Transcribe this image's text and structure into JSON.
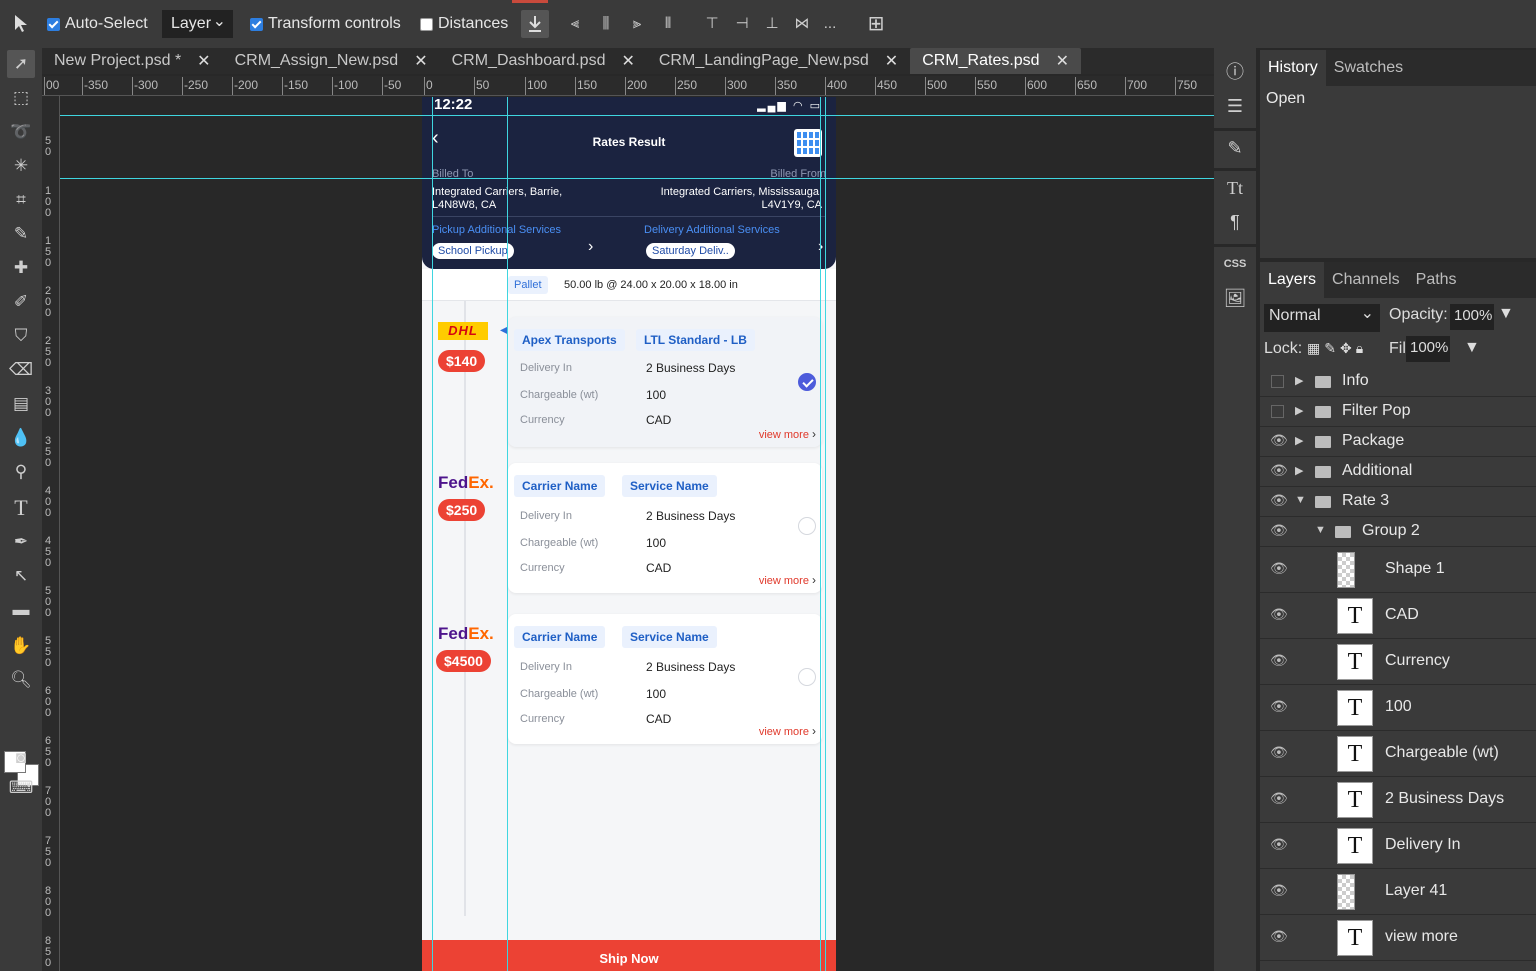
{
  "options_bar": {
    "auto_select_label": "Auto-Select",
    "auto_select_checked": true,
    "layer_select_value": "Layer",
    "transform_controls_label": "Transform controls",
    "transform_controls_checked": true,
    "distances_label": "Distances",
    "distances_checked": false,
    "more_label": "..."
  },
  "tabs": [
    {
      "label": "New Project.psd *",
      "active": false
    },
    {
      "label": "CRM_Assign_New.psd",
      "active": false
    },
    {
      "label": "CRM_Dashboard.psd",
      "active": false
    },
    {
      "label": "CRM_LandingPage_New.psd",
      "active": false
    },
    {
      "label": "CRM_Rates.psd",
      "active": true
    }
  ],
  "ruler": {
    "top_labels": [
      "00",
      "-350",
      "-300",
      "-250",
      "-200",
      "-150",
      "-100",
      "-50",
      "0",
      "50",
      "100",
      "150",
      "200",
      "250",
      "300",
      "350",
      "400",
      "450",
      "500",
      "550",
      "600",
      "650",
      "700",
      "750"
    ],
    "left_labels": [
      "50",
      "100",
      "150",
      "200",
      "250",
      "300",
      "350",
      "400",
      "450",
      "500",
      "550",
      "600",
      "650",
      "700",
      "750",
      "800",
      "850"
    ]
  },
  "artboard": {
    "status_time": "12:22",
    "title": "Rates Result",
    "billed_to_label": "Billed To",
    "billed_to_line1": "Integrated Carriers, Barrie,",
    "billed_to_line2": "L4N8W8, CA",
    "billed_from_label": "Billed From",
    "billed_from_line1": "Integrated Carriers, Mississauga,",
    "billed_from_line2": "L4V1Y9, CA",
    "pickup_label": "Pickup Additional Services",
    "pickup_chip": "School Pickup",
    "delivery_label": "Delivery Additional Services",
    "delivery_chip": "Saturday Deliv..",
    "pallet_chip": "Pallet",
    "pallet_text": "50.00 lb @ 24.00 x 20.00 x 18.00 in",
    "rates": [
      {
        "carrier": "DHL",
        "price": "$140",
        "chip1": "Apex Transports",
        "chip2": "LTL Standard - LB",
        "delivery_label": "Delivery In",
        "delivery_value": "2 Business Days",
        "weight_label": "Chargeable (wt)",
        "weight_value": "100",
        "currency_label": "Currency",
        "currency_value": "CAD",
        "view_more": "view more",
        "selected": true
      },
      {
        "carrier": "FedEx",
        "price": "$250",
        "chip1": "Carrier Name",
        "chip2": "Service Name",
        "delivery_label": "Delivery In",
        "delivery_value": "2 Business Days",
        "weight_label": "Chargeable (wt)",
        "weight_value": "100",
        "currency_label": "Currency",
        "currency_value": "CAD",
        "view_more": "view more",
        "selected": false
      },
      {
        "carrier": "FedEx",
        "price": "$4500",
        "chip1": "Carrier Name",
        "chip2": "Service Name",
        "delivery_label": "Delivery In",
        "delivery_value": "2 Business Days",
        "weight_label": "Chargeable (wt)",
        "weight_value": "100",
        "currency_label": "Currency",
        "currency_value": "CAD",
        "view_more": "view more",
        "selected": false
      }
    ],
    "ship_button": "Ship Now"
  },
  "right_strip": {
    "css_label": "CSS"
  },
  "history_panel": {
    "tabs": [
      "History",
      "Swatches"
    ],
    "items": [
      "Open"
    ]
  },
  "layers_panel": {
    "tabs": [
      "Layers",
      "Channels",
      "Paths"
    ],
    "blend_mode": "Normal",
    "opacity_label": "Opacity:",
    "opacity_value": "100%",
    "lock_label": "Lock:",
    "fill_label": "Fill:",
    "fill_value": "100%",
    "layers": [
      {
        "name": "Info",
        "type": "folder",
        "visible": false,
        "expanded": false,
        "indent": 0
      },
      {
        "name": "Filter Pop",
        "type": "folder",
        "visible": false,
        "expanded": false,
        "indent": 0
      },
      {
        "name": "Package",
        "type": "folder",
        "visible": true,
        "expanded": false,
        "indent": 0
      },
      {
        "name": "Additional",
        "type": "folder",
        "visible": true,
        "expanded": false,
        "indent": 0
      },
      {
        "name": "Rate 3",
        "type": "folder",
        "visible": true,
        "expanded": true,
        "indent": 0
      },
      {
        "name": "Group 2",
        "type": "folder",
        "visible": true,
        "expanded": true,
        "indent": 1
      },
      {
        "name": "Shape 1",
        "type": "shape",
        "visible": true,
        "indent": 2
      },
      {
        "name": "CAD",
        "type": "text",
        "visible": true,
        "indent": 2
      },
      {
        "name": "Currency",
        "type": "text",
        "visible": true,
        "indent": 2
      },
      {
        "name": "100",
        "type": "text",
        "visible": true,
        "indent": 2
      },
      {
        "name": "Chargeable (wt)",
        "type": "text",
        "visible": true,
        "indent": 2
      },
      {
        "name": "2 Business Days",
        "type": "text",
        "visible": true,
        "indent": 2
      },
      {
        "name": "Delivery In",
        "type": "text",
        "visible": true,
        "indent": 2
      },
      {
        "name": "Layer 41",
        "type": "raster",
        "visible": true,
        "indent": 2
      },
      {
        "name": "view more",
        "type": "text",
        "visible": true,
        "indent": 2
      }
    ]
  },
  "colors": {
    "accent_blue": "#2d7ee0",
    "guide_cyan": "#3fd6e0",
    "header_navy": "#1b2340",
    "price_red": "#ec4234",
    "chip_blue": "#1f5fc5"
  }
}
